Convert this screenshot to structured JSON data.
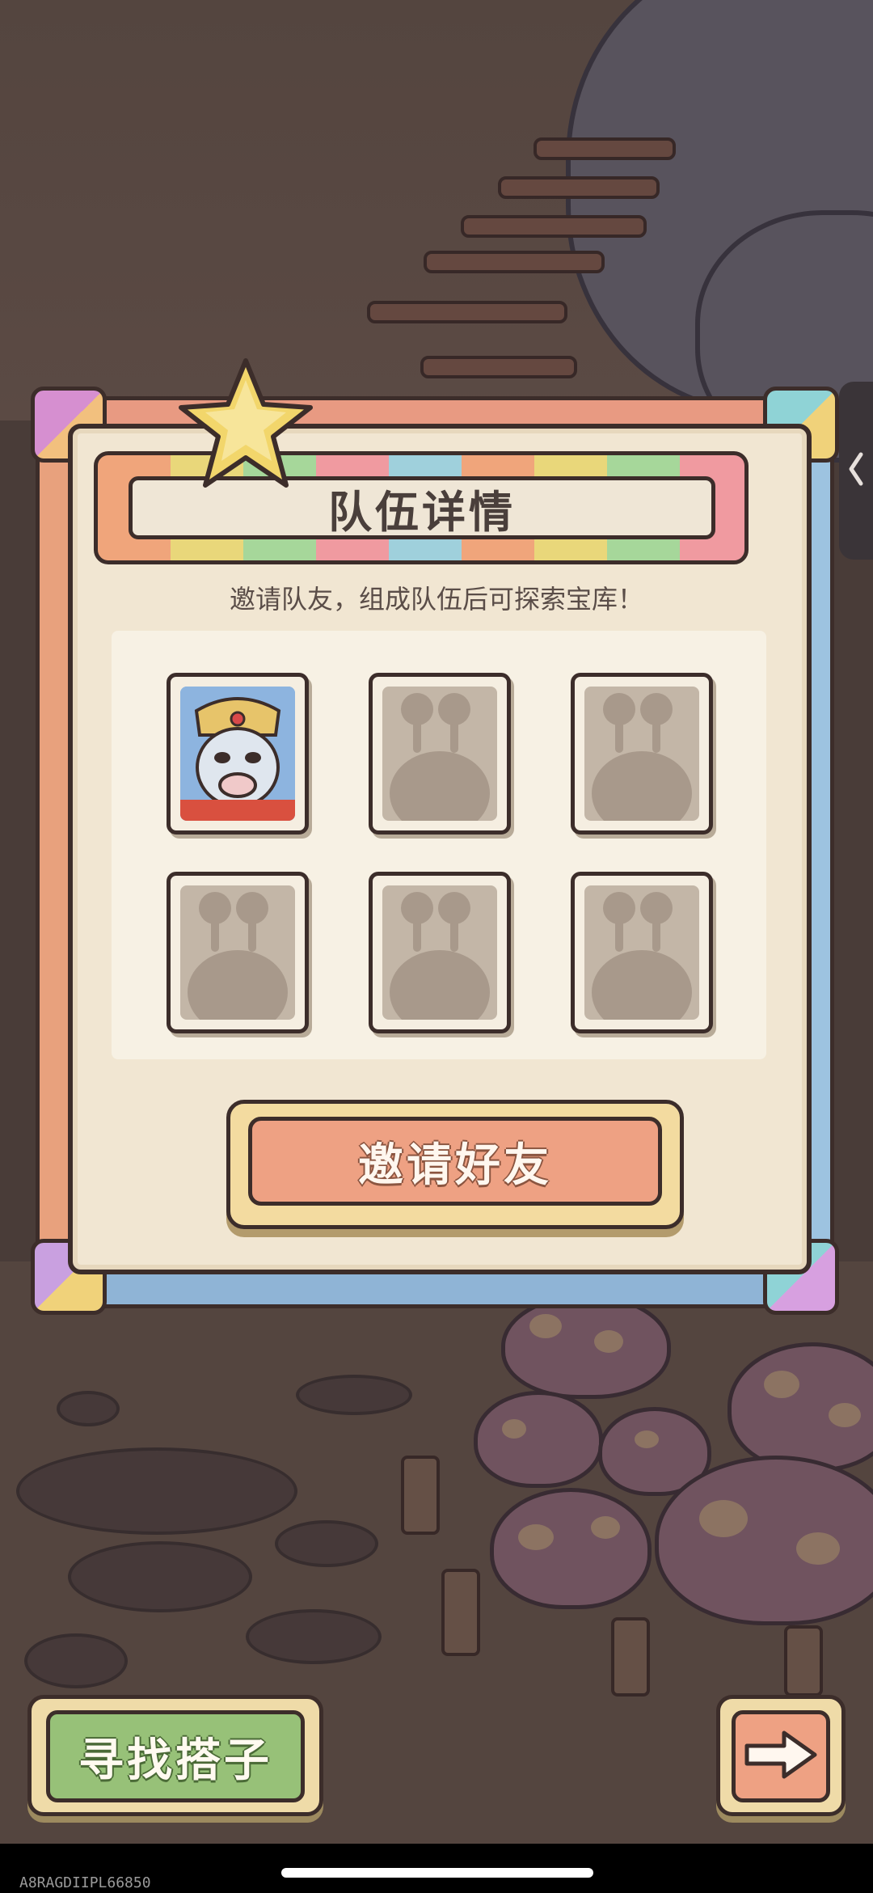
{
  "dialog": {
    "title": "队伍详情",
    "subtitle": "邀请队友，组成队伍后可探索宝库！",
    "invite_button": "邀请好友",
    "slots": [
      {
        "state": "filled",
        "avatar": "hero-portrait"
      },
      {
        "state": "empty"
      },
      {
        "state": "empty"
      },
      {
        "state": "empty"
      },
      {
        "state": "empty"
      },
      {
        "state": "empty"
      }
    ]
  },
  "bottom": {
    "find_partner_button": "寻找搭子",
    "next_icon": "arrow-right-icon"
  },
  "side_tab_icon": "chevron-left-icon",
  "watermark": "A8RAGDIIPL66850",
  "colors": {
    "panel": "#f1e6d2",
    "invite": "#eea183",
    "find": "#97c178",
    "outline": "#3c2d2a"
  }
}
